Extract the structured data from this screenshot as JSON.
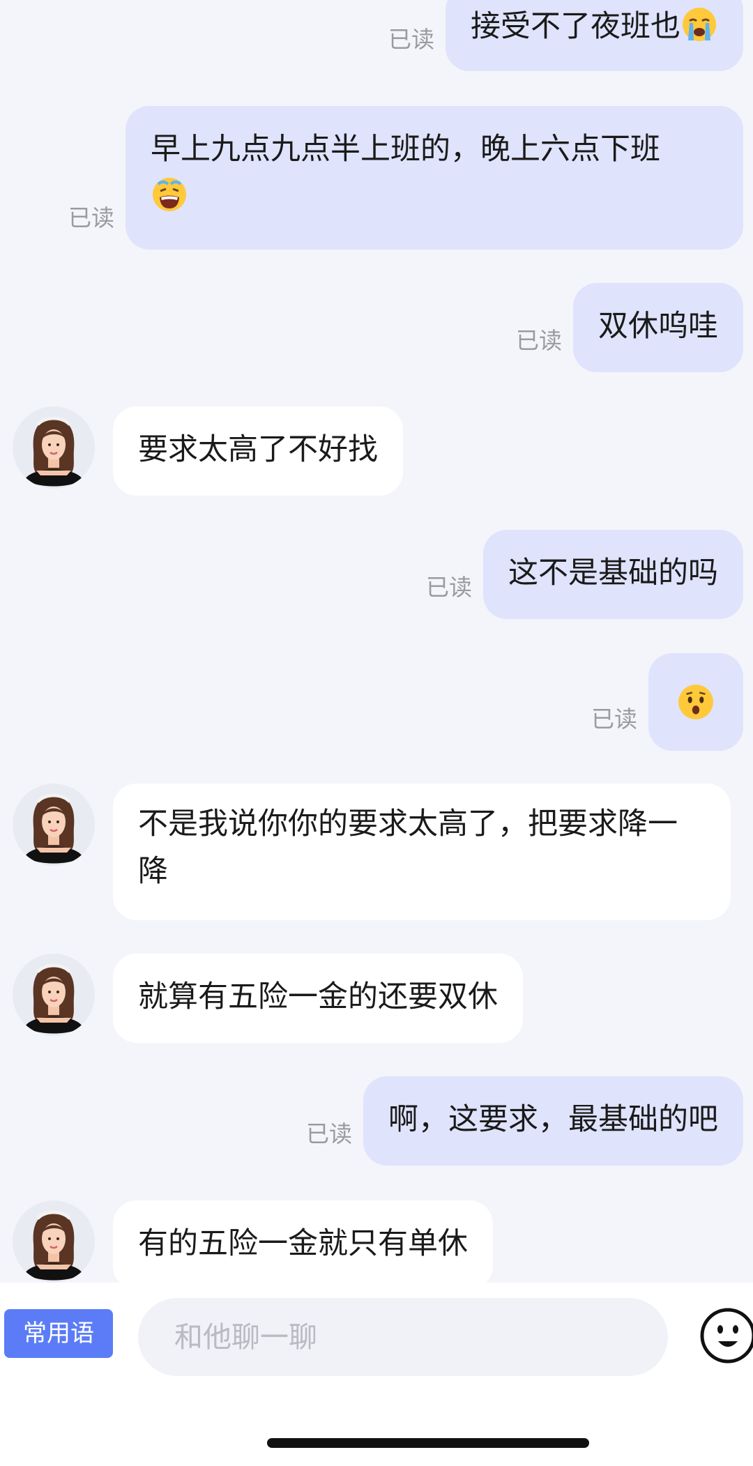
{
  "colors": {
    "background": "#f4f5fb",
    "sent_bubble": "#dfe3fb",
    "received_bubble": "#ffffff",
    "read_status": "#9a9aa0",
    "accent_button": "#5b7cf6"
  },
  "messages": [
    {
      "side": "sent",
      "text": "接受不了夜班也",
      "emoji": "loudly-crying-face",
      "status": "已读"
    },
    {
      "side": "sent",
      "text": "早上九点九点半上班的，晚上六点下班",
      "emoji": "tired-face",
      "status": "已读"
    },
    {
      "side": "sent",
      "text": "双休呜哇",
      "status": "已读"
    },
    {
      "side": "received",
      "text": "要求太高了不好找"
    },
    {
      "side": "sent",
      "text": "这不是基础的吗",
      "status": "已读"
    },
    {
      "side": "sent",
      "text": "",
      "emoji": "hushed-face",
      "status": "已读"
    },
    {
      "side": "received",
      "text": "不是我说你你的要求太高了，把要求降一降"
    },
    {
      "side": "received",
      "text": "就算有五险一金的还要双休"
    },
    {
      "side": "sent",
      "text": "啊，这要求，最基础的吧",
      "status": "已读"
    },
    {
      "side": "received",
      "text": "有的五险一金就只有单休"
    }
  ],
  "input_bar": {
    "phrases_label": "常用语",
    "placeholder": "和他聊一聊",
    "emoji_button_icon": "smiley-face-icon"
  }
}
